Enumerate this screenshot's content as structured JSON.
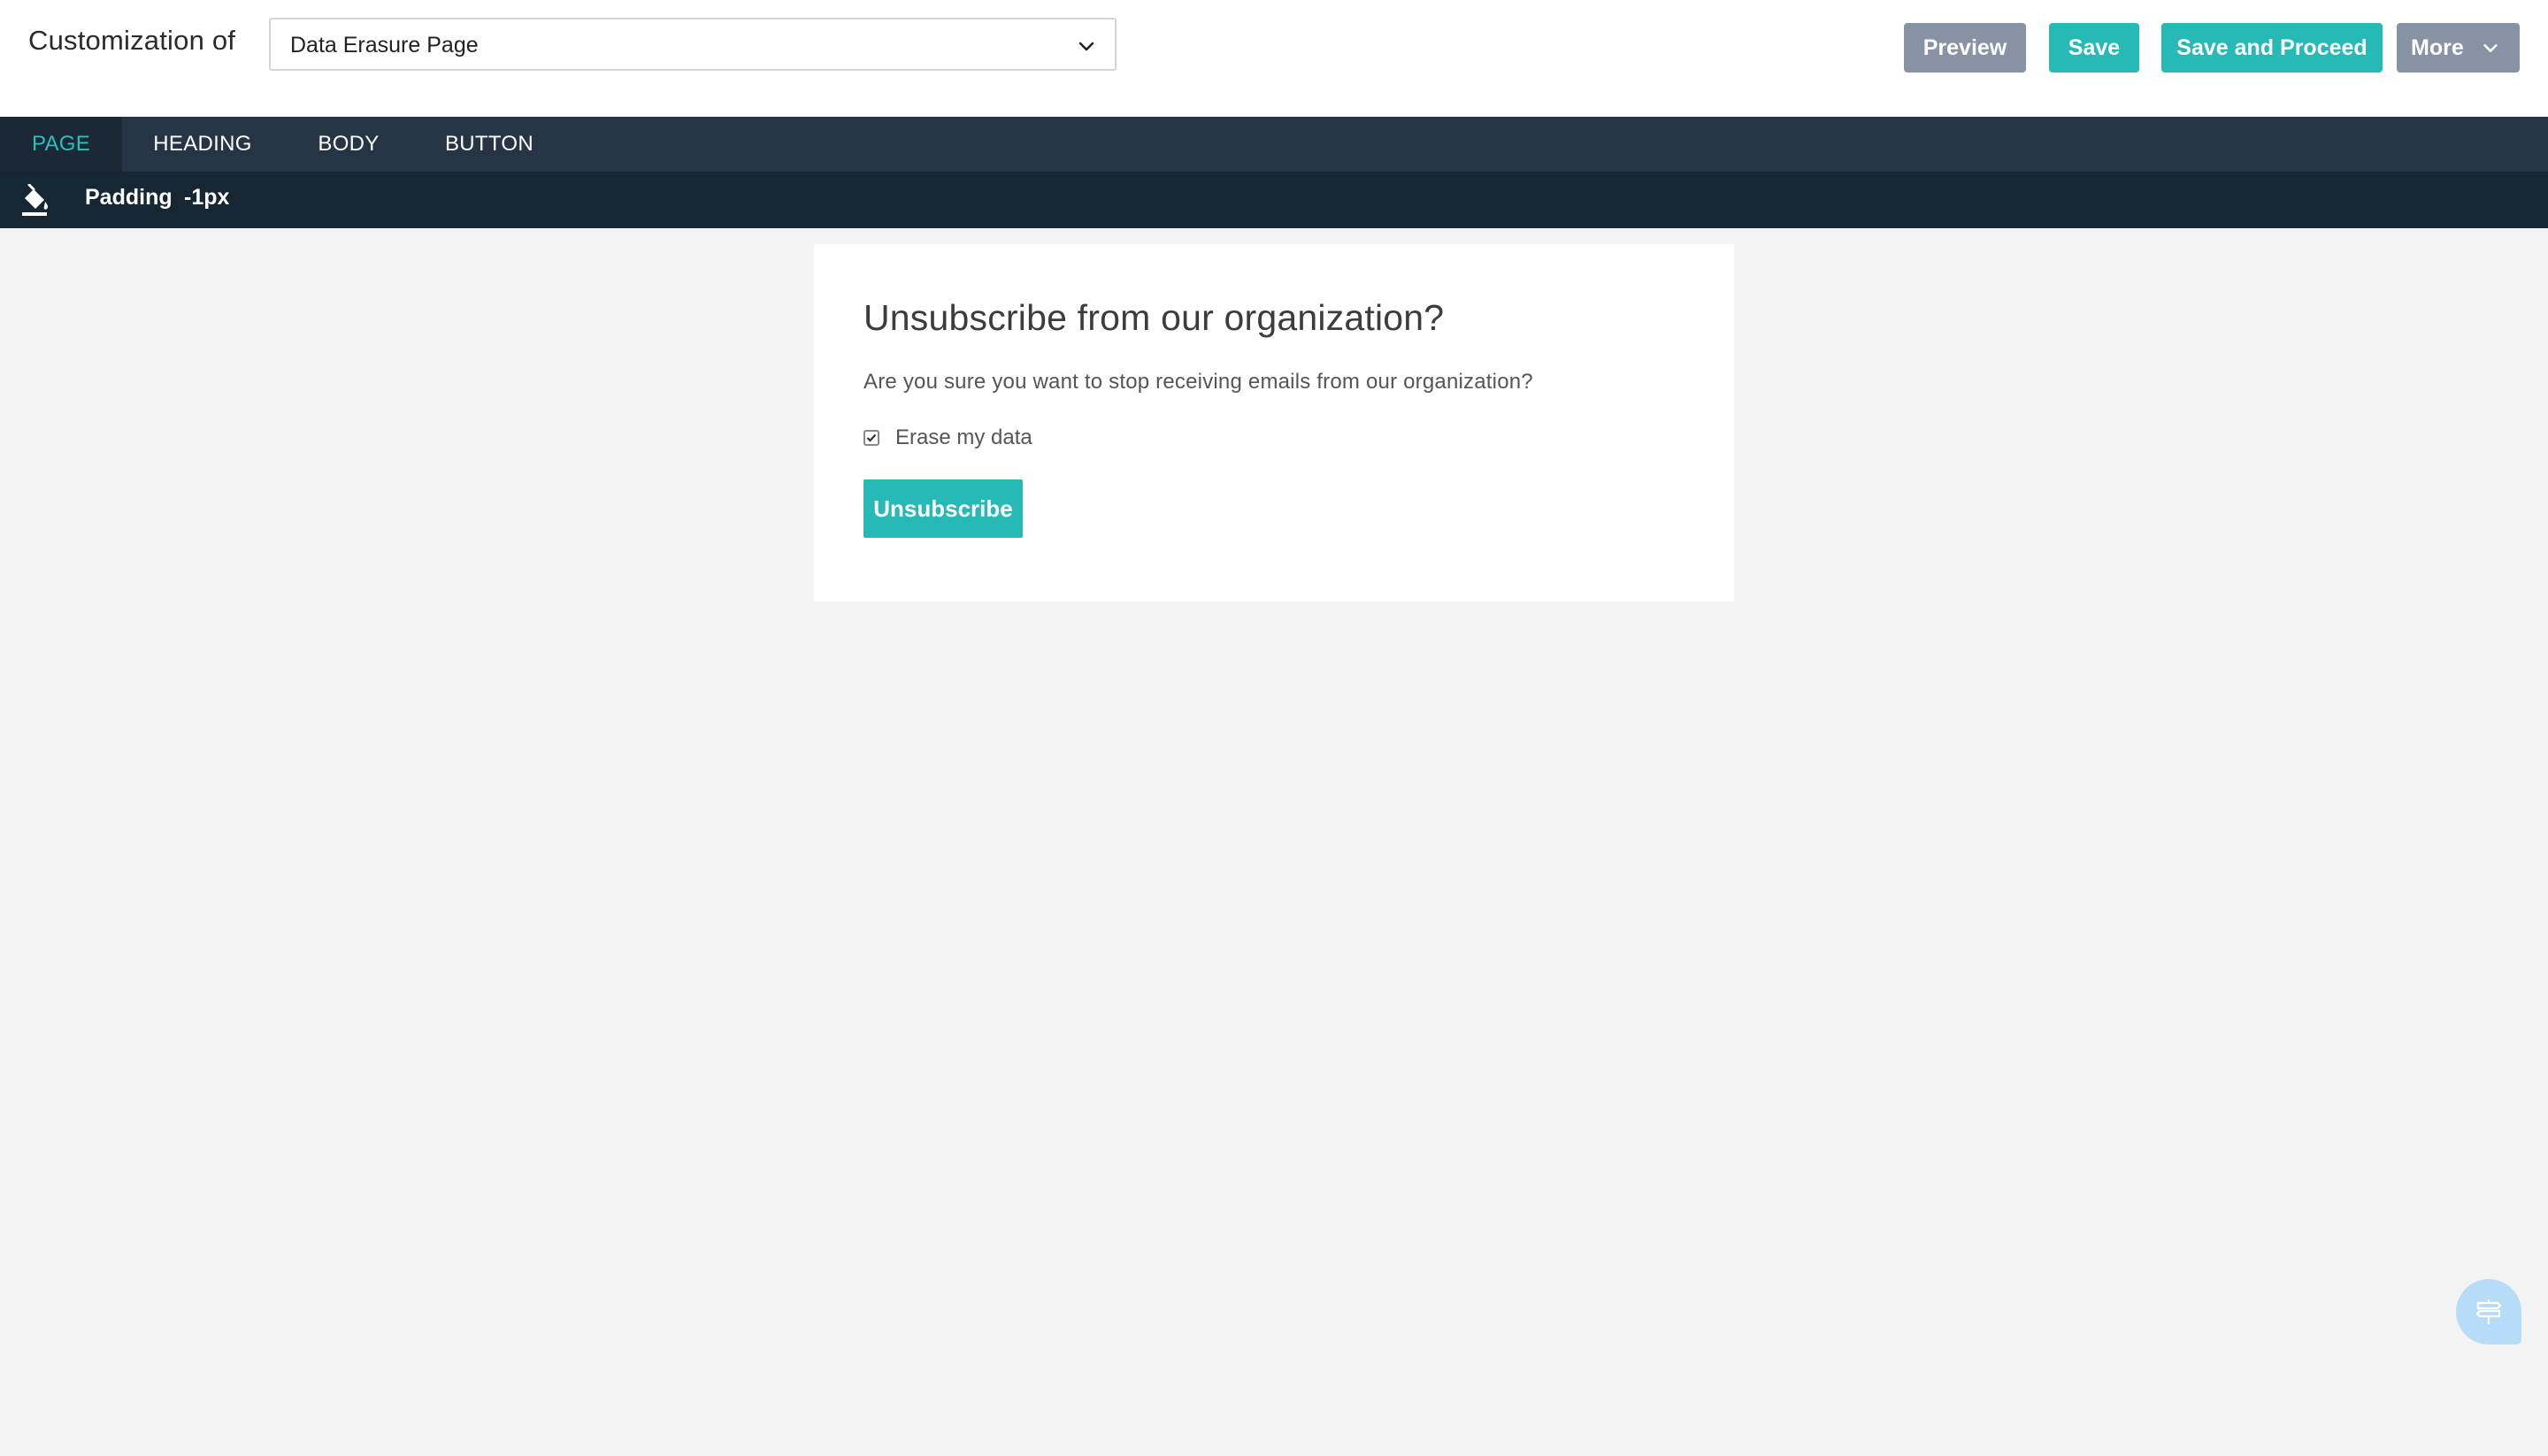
{
  "header": {
    "title": "Customization of",
    "page_select": {
      "selected": "Data Erasure Page"
    },
    "buttons": {
      "preview": "Preview",
      "save": "Save",
      "save_and_proceed": "Save and Proceed",
      "more": "More"
    }
  },
  "tabs": [
    {
      "label": "PAGE",
      "active": true
    },
    {
      "label": "HEADING",
      "active": false
    },
    {
      "label": "BODY",
      "active": false
    },
    {
      "label": "BUTTON",
      "active": false
    }
  ],
  "toolbar": {
    "fill_icon": "paint-bucket-icon",
    "padding_label": "Padding",
    "padding_value": "-1px"
  },
  "preview_card": {
    "heading": "Unsubscribe from our organization?",
    "body": "Are you sure you want to stop receiving emails from our organization?",
    "checkbox": {
      "label": "Erase my data",
      "checked": true
    },
    "button_label": "Unsubscribe"
  },
  "help_widget": {
    "icon": "signpost-icon"
  },
  "colors": {
    "accent": "#27b9b6",
    "gray_button": "#8793a5",
    "tabbar_bg": "#253545",
    "toolbar_bg": "#172633",
    "canvas_bg": "#f3f3f3"
  }
}
